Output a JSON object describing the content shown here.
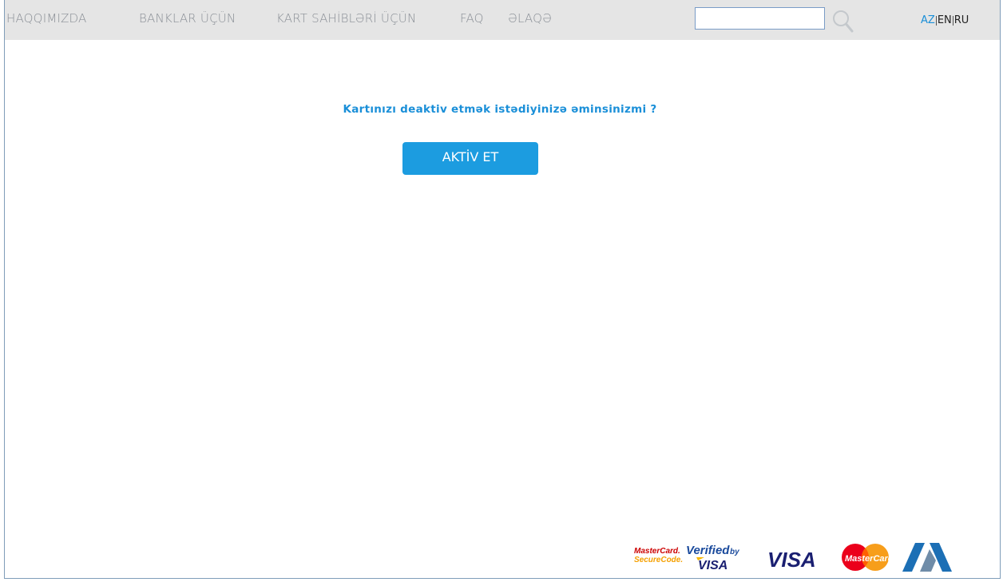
{
  "nav": {
    "items": [
      {
        "label": "HAQQIMIZDA"
      },
      {
        "label": "BANKLAR ÜÇÜN"
      },
      {
        "label": "KART SAHİBLƏRİ ÜÇÜN"
      },
      {
        "label": "FAQ"
      },
      {
        "label": "ƏLAQƏ"
      }
    ]
  },
  "search": {
    "value": "",
    "placeholder": "",
    "icon": "search-icon"
  },
  "languages": {
    "items": [
      {
        "label": "AZ",
        "active": true
      },
      {
        "label": "EN",
        "active": false
      },
      {
        "label": "RU",
        "active": false
      }
    ]
  },
  "main": {
    "question": "Kartınızı deaktiv etmək istədiyinizə əminsinizmi ?",
    "button_label": "AKTİV ET"
  },
  "footer": {
    "logos": {
      "mastercard_securecode_line1": "MasterCard.",
      "mastercard_securecode_line2": "SecureCode.",
      "verified_by": "Verified",
      "verified_by_small": "by",
      "verified_visa": "VISA",
      "visa": "VISA",
      "mastercard": "MasterCard"
    }
  },
  "colors": {
    "accent": "#1a8fd8",
    "button": "#1c9ce0",
    "topbar": "#e5e5e5",
    "nav_text": "#8a8f96"
  }
}
